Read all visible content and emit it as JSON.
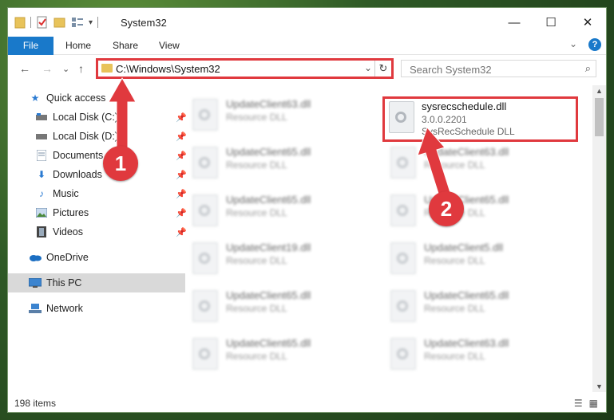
{
  "window": {
    "title": "System32",
    "minimize": "—",
    "maximize": "☐",
    "close": "✕"
  },
  "ribbon": {
    "tabs": [
      "File",
      "Home",
      "Share",
      "View"
    ],
    "expand": "⌄",
    "help": "?"
  },
  "navigation": {
    "back": "←",
    "forward": "→",
    "recent": "⌄",
    "up": "↑",
    "address_path": "C:\\Windows\\System32",
    "address_dropdown": "⌄",
    "refresh": "↻",
    "search_placeholder": "Search System32"
  },
  "sidebar": {
    "items": [
      {
        "label": "Quick access",
        "icon": "star-icon",
        "pinned": false
      },
      {
        "label": "Local Disk (C:)",
        "icon": "drive-icon",
        "pinned": true
      },
      {
        "label": "Local Disk (D:)",
        "icon": "drive-icon",
        "pinned": true
      },
      {
        "label": "Documents",
        "icon": "documents-icon",
        "pinned": true
      },
      {
        "label": "Downloads",
        "icon": "download-icon",
        "pinned": true
      },
      {
        "label": "Music",
        "icon": "music-icon",
        "pinned": true
      },
      {
        "label": "Pictures",
        "icon": "pictures-icon",
        "pinned": true
      },
      {
        "label": "Videos",
        "icon": "videos-icon",
        "pinned": true
      },
      {
        "label": "OneDrive",
        "icon": "cloud-icon",
        "pinned": false
      },
      {
        "label": "This PC",
        "icon": "computer-icon",
        "pinned": false,
        "selected": true
      },
      {
        "label": "Network",
        "icon": "network-icon",
        "pinned": false
      }
    ]
  },
  "files": [
    {
      "name": "UpdateClient63.dll",
      "desc": "Resource DLL"
    },
    {
      "name": "sysrecschedule.dll",
      "desc": "3.0.0.2201",
      "desc2": "SysRecSchedule DLL",
      "highlighted": true
    },
    {
      "name": "UpdateClient65.dll",
      "desc": "Resource DLL"
    },
    {
      "name": "UpdateClient63.dll",
      "desc": "Resource DLL"
    },
    {
      "name": "UpdateClient65.dll",
      "desc": "Resource DLL"
    },
    {
      "name": "UpdateClient65.dll",
      "desc": "Resource DLL"
    },
    {
      "name": "UpdateClient19.dll",
      "desc": "Resource DLL"
    },
    {
      "name": "UpdateClient5.dll",
      "desc": "Resource DLL"
    },
    {
      "name": "UpdateClient65.dll",
      "desc": "Resource DLL"
    },
    {
      "name": "UpdateClient65.dll",
      "desc": "Resource DLL"
    },
    {
      "name": "UpdateClient65.dll",
      "desc": "Resource DLL"
    },
    {
      "name": "UpdateClient63.dll",
      "desc": "Resource DLL"
    }
  ],
  "status": {
    "item_count": "198 items"
  },
  "annotations": {
    "step1": "1",
    "step2": "2",
    "color": "#e0393e"
  }
}
